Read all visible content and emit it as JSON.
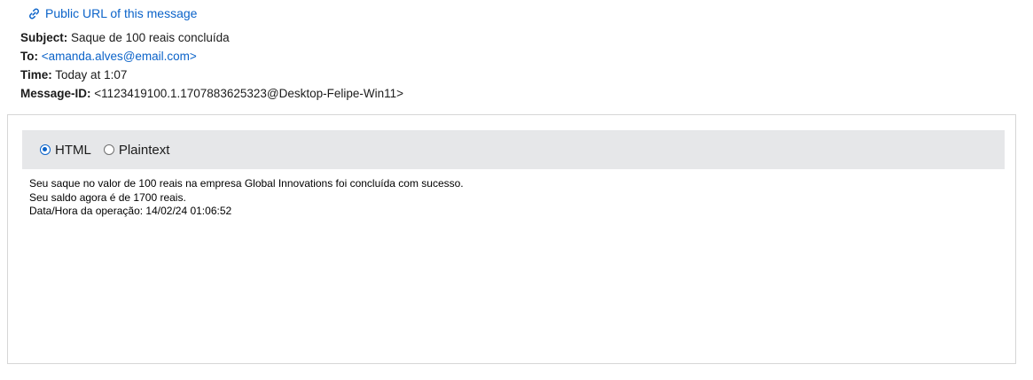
{
  "public_url": {
    "label": "Public URL of this message",
    "icon": "link-icon"
  },
  "meta": {
    "subject_key": "Subject:",
    "subject_value": "Saque de 100 reais concluída",
    "to_key": "To:",
    "to_value": "<amanda.alves@email.com>",
    "time_key": "Time:",
    "time_value": "Today at 1:07",
    "message_id_key": "Message-ID:",
    "message_id_value": "<1123419100.1.1707883625323@Desktop-Felipe-Win11>"
  },
  "view_toggle": {
    "options": [
      {
        "label": "HTML",
        "selected": true
      },
      {
        "label": "Plaintext",
        "selected": false
      }
    ]
  },
  "message_body": {
    "lines": [
      "Seu saque no valor de 100 reais na empresa Global Innovations foi concluída com sucesso.",
      "Seu saldo agora é de 1700 reais.",
      "Data/Hora da operação: 14/02/24 01:06:52"
    ]
  },
  "colors": {
    "link": "#0b63c9",
    "toolbar_bg": "#e6e7e9",
    "frame_border": "#d6d6d6"
  }
}
